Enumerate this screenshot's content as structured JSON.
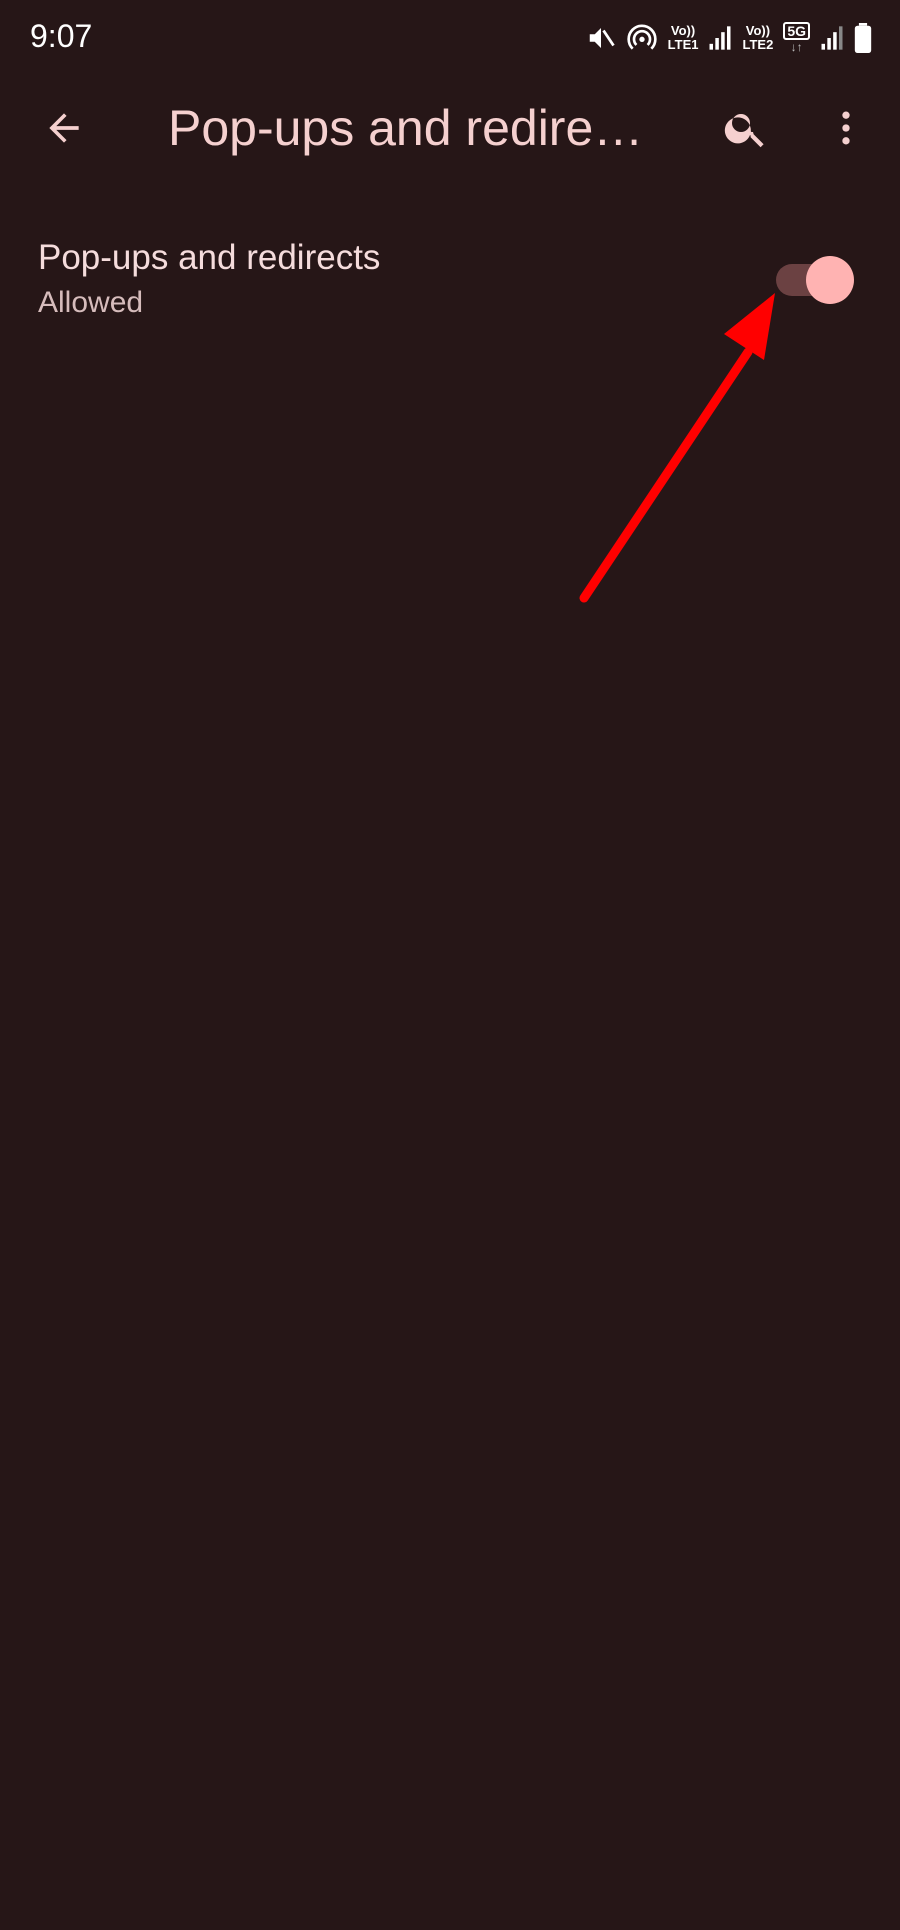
{
  "status_bar": {
    "time": "9:07",
    "sim1_top": "Vo))",
    "sim1_bottom": "LTE1",
    "sim2_top": "Vo))",
    "sim2_bottom": "LTE2",
    "network_badge": "5G",
    "icons": [
      "mute-icon",
      "hotspot-icon",
      "signal-icon",
      "signal-icon",
      "battery-icon"
    ]
  },
  "app_bar": {
    "title": "Pop-ups and redire…",
    "icons": [
      "back-arrow-icon",
      "search-icon",
      "more-vert-icon"
    ]
  },
  "setting": {
    "title": "Pop-ups and redirects",
    "summary": "Allowed",
    "enabled": true
  },
  "colors": {
    "background": "#261617",
    "accent": "#ffb3b2",
    "track": "#6b4142",
    "annotation": "#ff0000"
  }
}
